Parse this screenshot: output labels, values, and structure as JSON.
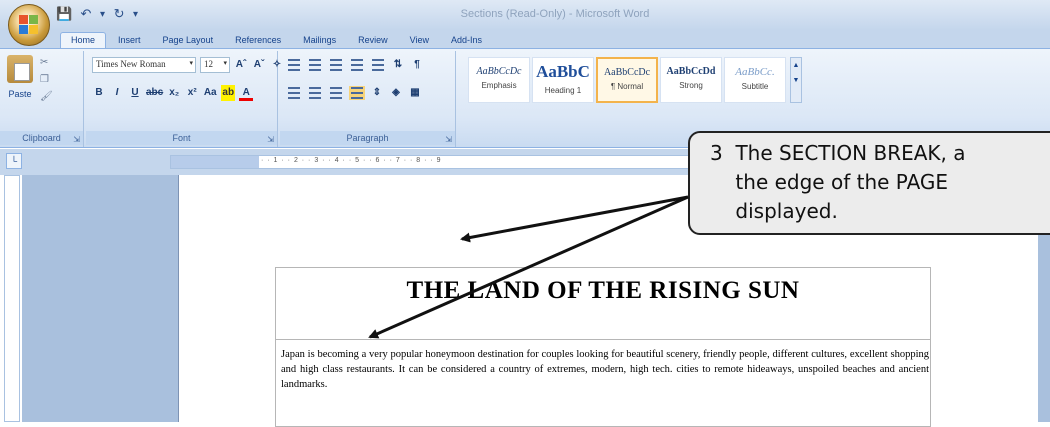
{
  "window": {
    "title": "Sections (Read-Only) - Microsoft Word"
  },
  "tabs": [
    "Home",
    "Insert",
    "Page Layout",
    "References",
    "Mailings",
    "Review",
    "View",
    "Add-Ins"
  ],
  "clipboard": {
    "paste_label": "Paste",
    "group_label": "Clipboard"
  },
  "font": {
    "name": "Times New Roman",
    "size": "12",
    "group_label": "Font"
  },
  "paragraph": {
    "group_label": "Paragraph"
  },
  "styles": {
    "items": [
      {
        "sample": "AaBbCcDc",
        "name": "Emphasis"
      },
      {
        "sample": "AaBbC",
        "name": "Heading 1"
      },
      {
        "sample": "AaBbCcDc",
        "name": "¶ Normal"
      },
      {
        "sample": "AaBbCcDd",
        "name": "Strong"
      },
      {
        "sample": "AaBbCc.",
        "name": "Subtitle"
      }
    ]
  },
  "document": {
    "title": "THE LAND OF THE RISING SUN",
    "body": "Japan is becoming a very popular honeymoon destination for couples looking for beautiful scenery, friendly people, different cultures, excellent shopping and high class restaurants. It can be considered a country of extremes, modern, high tech. cities to remote hideaways, unspoiled beaches and ancient landmarks."
  },
  "callout": {
    "line1": "3  The SECTION BREAK, a",
    "line2": "    the edge of the PAGE",
    "line3": "    displayed."
  },
  "colors": {
    "ribbon_bg": "#dbe7f6",
    "doc_bg": "#a9c0dd",
    "selected_style": "#f3b34c"
  }
}
